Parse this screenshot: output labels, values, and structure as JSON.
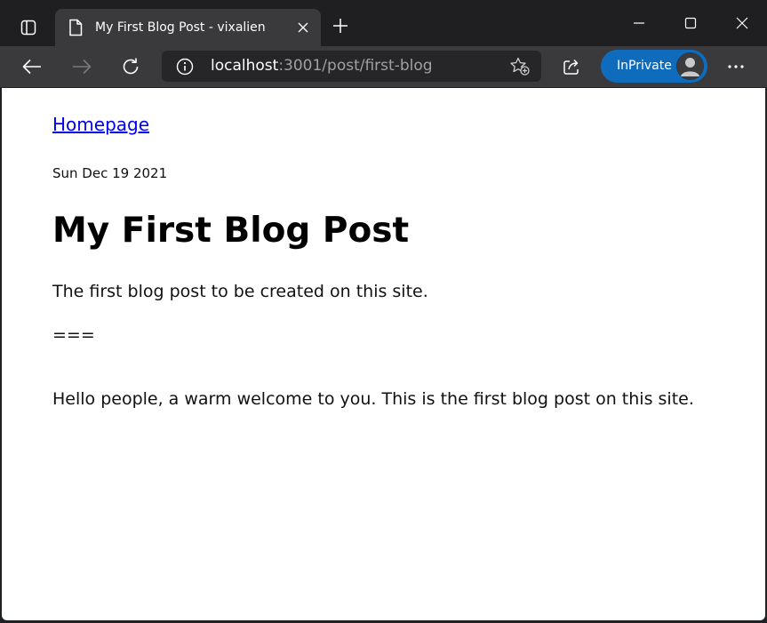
{
  "browser": {
    "tab": {
      "title": "My First Blog Post - vixalien",
      "favicon": "document-icon"
    },
    "address": {
      "host": "localhost",
      "rest": ":3001/post/first-blog"
    },
    "inprivate_label": "InPrivate",
    "colors": {
      "chrome": "#1f1f22",
      "toolbar": "#3a3a3d",
      "inprivate": "#0f6cbd"
    }
  },
  "page": {
    "home_link": "Homepage",
    "date": "Sun Dec 19 2021",
    "title": "My First Blog Post",
    "paragraphs": [
      "The first blog post to be created on this site.",
      "===",
      "Hello people, a warm welcome to you. This is the first blog post on this site."
    ],
    "link_color": "#0000ee"
  }
}
